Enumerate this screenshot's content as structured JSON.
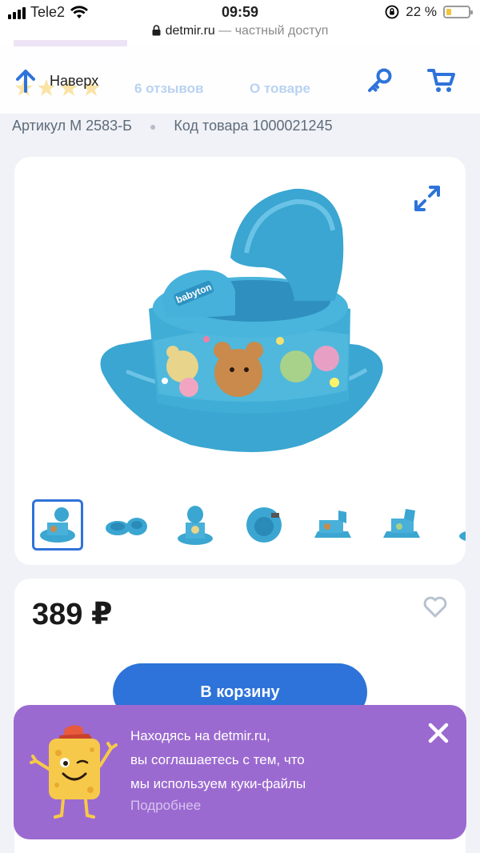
{
  "status_bar": {
    "carrier": "Tele2",
    "time": "09:59",
    "battery_percent": "22 %",
    "battery_level": 0.22
  },
  "url_bar": {
    "host": "detmir.ru",
    "suffix": " — частный доступ"
  },
  "header": {
    "back_label": "Наверх",
    "faded_reviews": "6 отзывов",
    "faded_about": "О товаре"
  },
  "product": {
    "article": "Артикул M 2583-Б",
    "code": "Код товара 1000021245",
    "price": "389 ₽",
    "add_to_cart": "В корзину",
    "brand_on_image": "babyton"
  },
  "cookie_banner": {
    "line1": "Находясь на detmir.ru,",
    "line2": "вы соглашаетесь с тем, что",
    "line3": "мы используем куки-файлы",
    "more_link": "Подробнее"
  },
  "colors": {
    "accent_blue": "#2d73d9",
    "potty_blue": "#3fa9d4",
    "banner_purple": "#9b6ad0",
    "battery_yellow": "#f2c53d"
  }
}
